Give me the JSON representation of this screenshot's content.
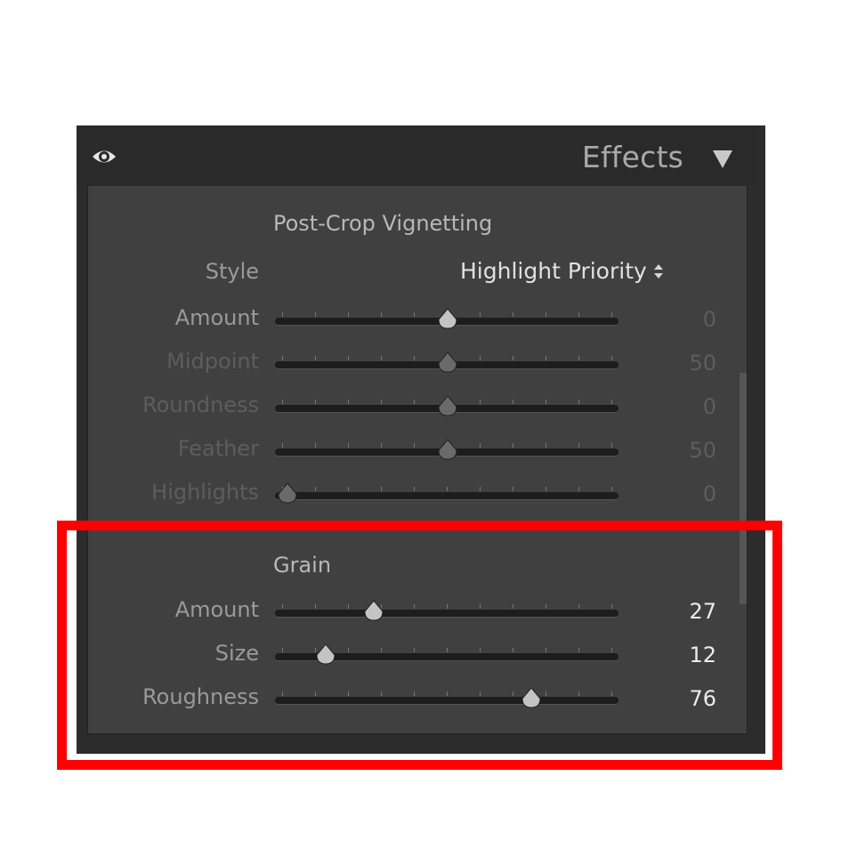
{
  "panel": {
    "title": "Effects"
  },
  "vignette": {
    "title": "Post-Crop Vignetting",
    "style_label": "Style",
    "style_value": "Highlight Priority",
    "sliders": [
      {
        "label": "Amount",
        "value": "0",
        "fraction": 0.5,
        "state": "enabled"
      },
      {
        "label": "Midpoint",
        "value": "50",
        "fraction": 0.5,
        "state": "disabled"
      },
      {
        "label": "Roundness",
        "value": "0",
        "fraction": 0.5,
        "state": "disabled"
      },
      {
        "label": "Feather",
        "value": "50",
        "fraction": 0.5,
        "state": "disabled"
      },
      {
        "label": "Highlights",
        "value": "0",
        "fraction": 0.0,
        "state": "disabled"
      }
    ]
  },
  "grain": {
    "title": "Grain",
    "sliders": [
      {
        "label": "Amount",
        "value": "27",
        "fraction": 0.27,
        "state": "active"
      },
      {
        "label": "Size",
        "value": "12",
        "fraction": 0.12,
        "state": "active"
      },
      {
        "label": "Roughness",
        "value": "76",
        "fraction": 0.76,
        "state": "active"
      }
    ]
  },
  "colors": {
    "highlight_box": "#ff0000",
    "panel_bg": "#404040",
    "header_bg": "#2a2a2a"
  }
}
